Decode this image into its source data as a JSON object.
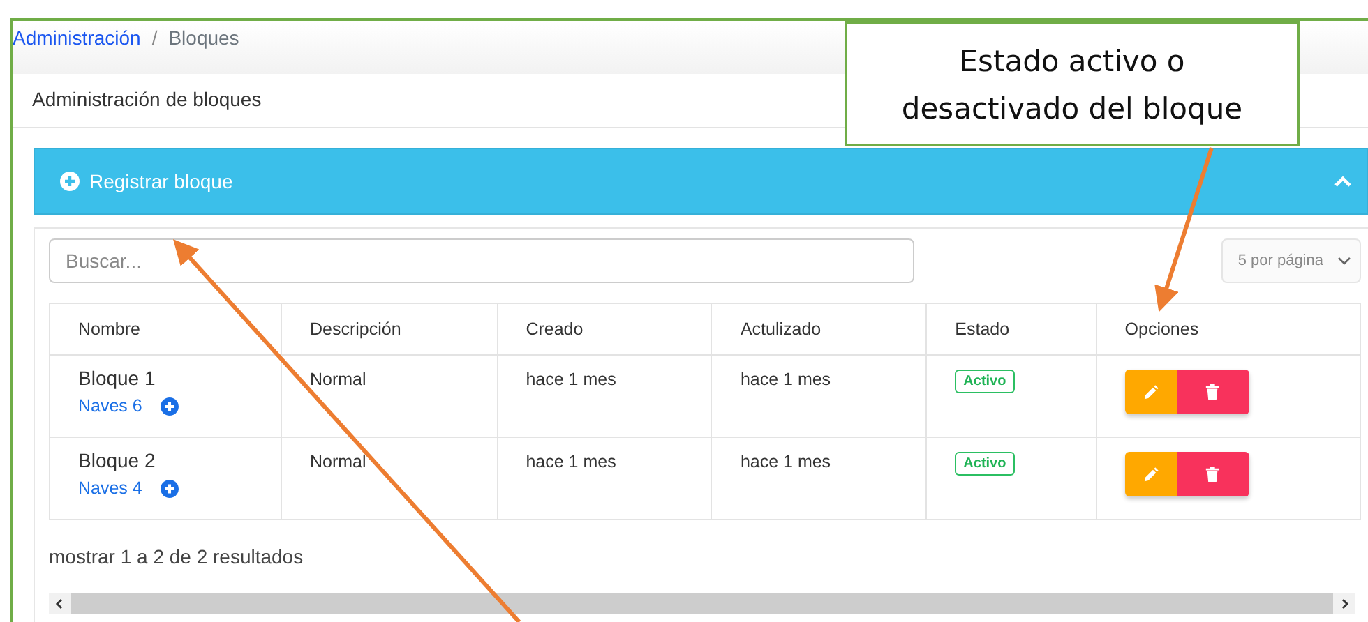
{
  "breadcrumb": [
    {
      "label": "Administración",
      "link": true
    },
    {
      "label": "Bloques",
      "link": false
    }
  ],
  "breadcrumb_separator": "/",
  "page_title": "Administración de bloques",
  "register_panel": {
    "label": "Registrar bloque",
    "expanded": true
  },
  "search": {
    "placeholder": "Buscar..."
  },
  "page_size": {
    "value": "5 por página"
  },
  "table": {
    "columns": [
      "Nombre",
      "Descripción",
      "Creado",
      "Actulizado",
      "Estado",
      "Opciones"
    ],
    "rows": [
      {
        "name": "Bloque 1",
        "link": "Naves 6",
        "description": "Normal",
        "created": "hace 1 mes",
        "updated": "hace 1 mes",
        "status": {
          "label": "Activo",
          "active": true
        }
      },
      {
        "name": "Bloque 2",
        "link": "Naves 4",
        "description": "Normal",
        "created": "hace 1 mes",
        "updated": "hace 1 mes",
        "status": {
          "label": "Activo",
          "active": true
        }
      }
    ]
  },
  "results_text": "mostrar 1 a 2 de 2 resultados",
  "callout": {
    "text": "Estado activo o desactivado del bloque"
  }
}
